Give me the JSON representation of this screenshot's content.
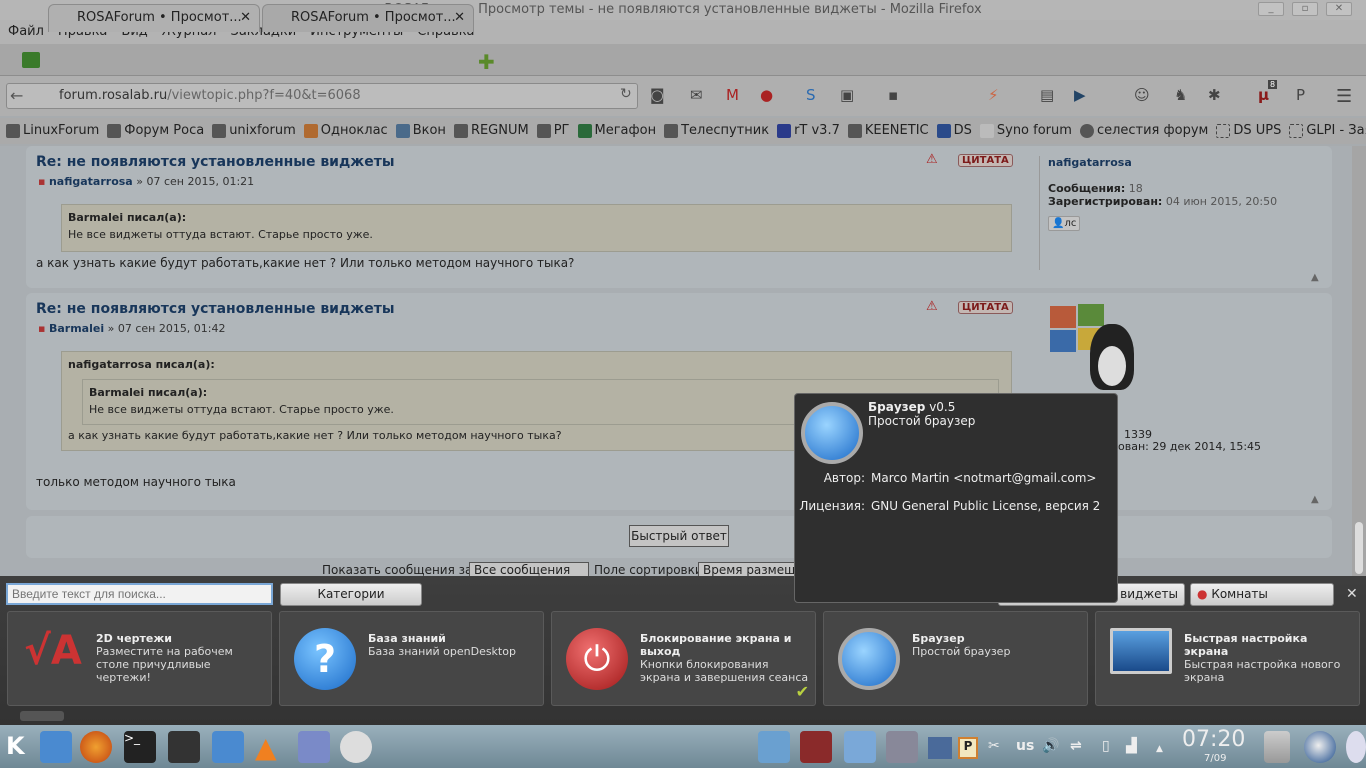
{
  "window": {
    "title": "ROSAForum • Просмотр темы - не появляются установленные виджеты - Mozilla Firefox"
  },
  "menu": [
    "Файл",
    "Правка",
    "Вид",
    "Журнал",
    "Закладки",
    "Инструменты",
    "Справка"
  ],
  "tabs": [
    {
      "label": "ROSAForum • Просмот..."
    },
    {
      "label": "ROSAForum • Просмот..."
    }
  ],
  "url": {
    "domain": "forum.rosalab.ru",
    "path": "/viewtopic.php?f=40&t=6068"
  },
  "toolbar": {
    "badge_count": "8"
  },
  "bookmarks": [
    "LinuxForum",
    "Форум Роса",
    "unixforum",
    "Одноклас",
    "Вкон",
    "REGNUM",
    "РГ",
    "Мегафон",
    "Телеспутник",
    "rT v3.7",
    "KEENETIC",
    "DS",
    "Syno forum",
    "селестия форум",
    "DS UPS",
    "GLPI - Заявки",
    "»"
  ],
  "posts": [
    {
      "title": "Re: не появляются установленные виджеты",
      "author": "nafigatarrosa",
      "date": "» 07 сен 2015, 01:21",
      "quote_author": "Barmalei писал(а):",
      "quote_text": "Не все виджеты оттуда встают. Старье просто уже.",
      "text": "а как узнать какие будут работать,какие нет ? Или только методом научного тыка?",
      "cite": "ЦИТАТА",
      "profile": {
        "name": "nafigatarrosa",
        "posts_label": "Сообщения:",
        "posts": "18",
        "reg_label": "Зарегистрирован:",
        "reg": "04 июн 2015, 20:50",
        "pm": "лс"
      }
    },
    {
      "title": "Re: не появляются установленные виджеты",
      "author": "Barmalei",
      "date": "» 07 сен 2015, 01:42",
      "quote_author": "nafigatarrosa писал(а):",
      "inner_quote_author": "Barmalei писал(а):",
      "inner_quote_text": "Не все виджеты оттуда встают. Старье просто уже.",
      "quote_text": "а как узнать какие будут работать,какие нет ? Или только методом научного тыка?",
      "text": "только методом научного тыка",
      "cite": "ЦИТАТА",
      "profile": {
        "posts": "1339",
        "reg": "ован: 29 дек 2014, 15:45"
      }
    }
  ],
  "quick_reply": "Быстрый ответ",
  "sort": {
    "show_label": "Показать сообщения за:",
    "show_value": "Все сообщения",
    "sort_label": "Поле сортировки",
    "sort_value": "Время размеще"
  },
  "launcher": {
    "search_placeholder": "Введите текст для поиска...",
    "categories": "Категории",
    "tab_widgets": "е виджеты",
    "tab_rooms": "Комнаты",
    "cards": [
      {
        "title": "2D чертежи",
        "desc": "Разместите на рабочем столе причудливые чертежи!"
      },
      {
        "title": "База знаний",
        "desc": "База знаний openDesktop"
      },
      {
        "title": "Блокирование экрана и выход",
        "desc": "Кнопки блокирования экрана и завершения сеанса"
      },
      {
        "title": "Браузер",
        "desc": "Простой браузер"
      },
      {
        "title": "Быстрая настройка экрана",
        "desc": "Быстрая настройка нового экрана"
      }
    ]
  },
  "tooltip": {
    "name": "Браузер",
    "version": "v0.5",
    "desc": "Простой браузер",
    "author_label": "Автор:",
    "author": "Marco Martin <notmart@gmail.com>",
    "license_label": "Лицензия:",
    "license": "GNU General Public License, версия 2"
  },
  "taskbar": {
    "layout": "us",
    "time": "07:20",
    "date": "7/09"
  }
}
